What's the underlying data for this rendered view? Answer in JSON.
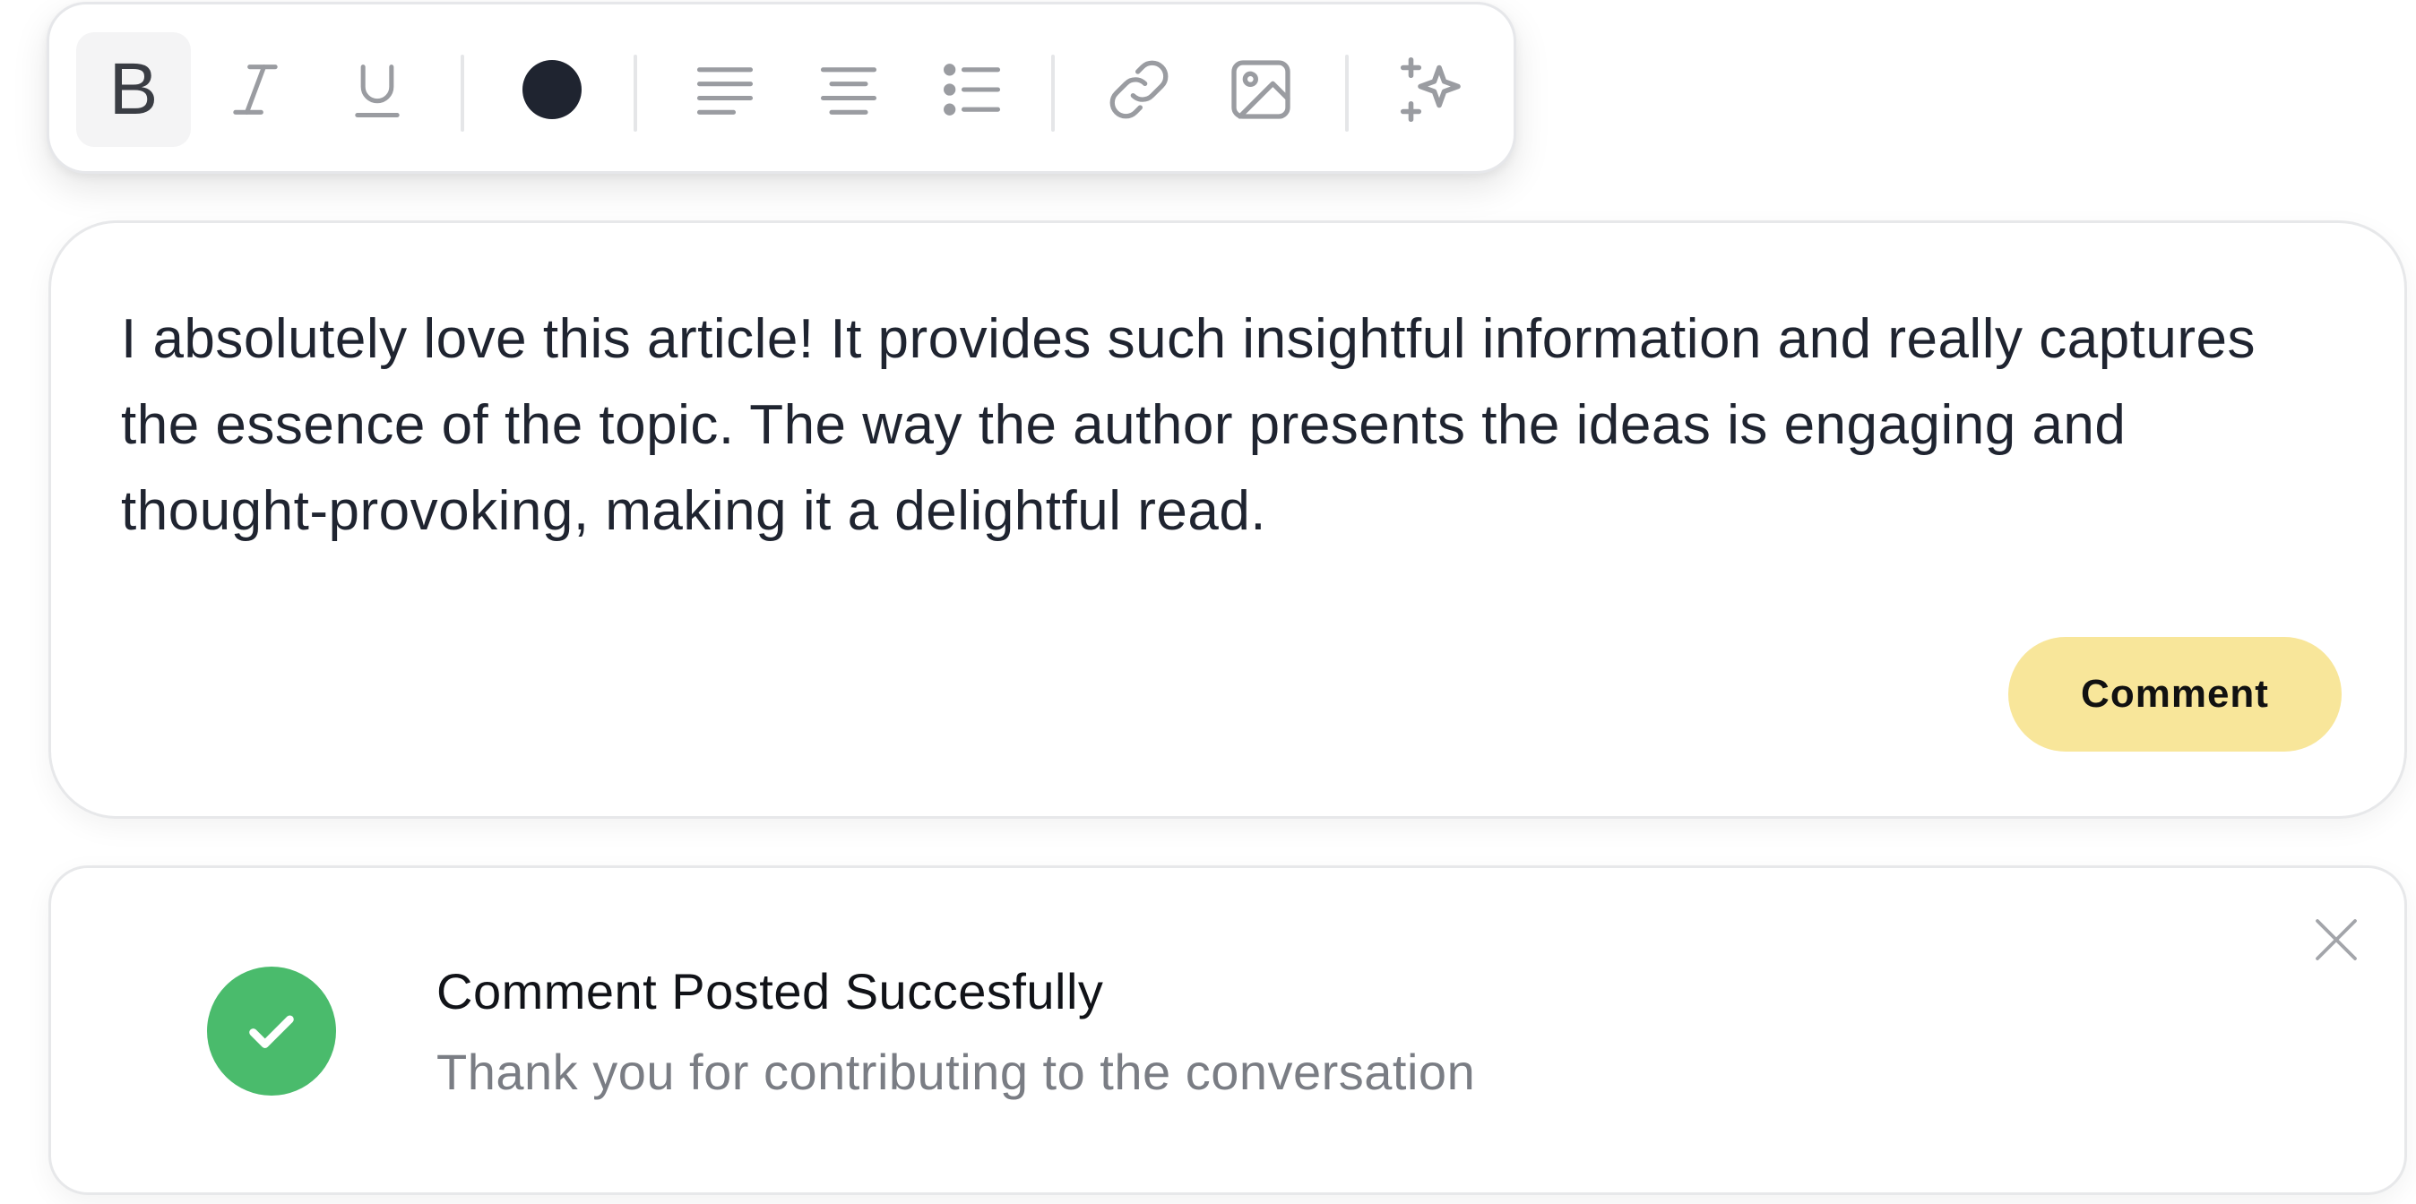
{
  "toolbar": {
    "tools": [
      {
        "name": "bold",
        "glyph": "B",
        "icon": "bold-icon",
        "active": true
      },
      {
        "name": "italic",
        "icon": "italic-icon"
      },
      {
        "name": "underline",
        "icon": "underline-icon"
      },
      {
        "name": "text-color",
        "icon": "color-swatch-icon",
        "color": "#1f2430"
      },
      {
        "name": "align-left",
        "icon": "align-left-icon"
      },
      {
        "name": "align-center",
        "icon": "align-center-icon"
      },
      {
        "name": "bullet-list",
        "icon": "bullet-list-icon"
      },
      {
        "name": "link",
        "icon": "link-icon"
      },
      {
        "name": "image",
        "icon": "image-icon"
      },
      {
        "name": "ai-sparkle",
        "icon": "sparkle-icon"
      }
    ]
  },
  "comment": {
    "text": "I absolutely love this article! It provides such insightful information and really captures the essence of the topic. The way the author presents the ideas is engaging and thought-provoking, making it a delightful read.",
    "submit_label": "Comment",
    "submit_color": "#f8e69a"
  },
  "toast": {
    "title": "Comment Posted Succesfully",
    "message": "Thank you for contributing to the conversation",
    "status_icon": "check-circle-icon",
    "status_color": "#4abb6c",
    "close_icon": "close-icon"
  },
  "colors": {
    "icon_gray": "#9a9ca1",
    "text_dark": "#1f2430",
    "muted_text": "#7a7d84"
  }
}
